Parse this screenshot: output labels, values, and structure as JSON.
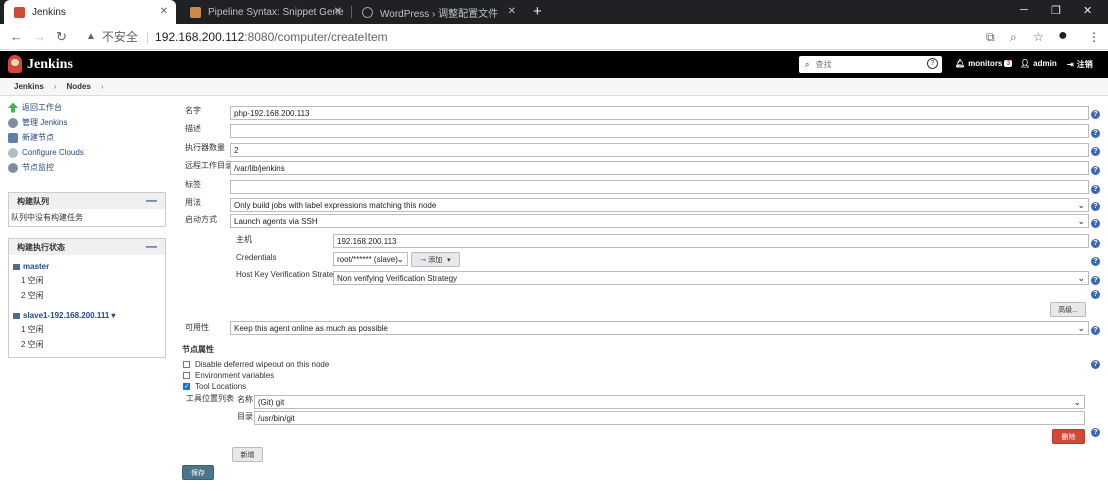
{
  "browser": {
    "tabs": [
      {
        "title": "Jenkins",
        "active": true
      },
      {
        "title": "Pipeline Syntax: Snippet Gene",
        "active": false
      },
      {
        "title": "WordPress › 调整配置文件",
        "active": false
      }
    ],
    "new_tab": "+",
    "insecure_label": "不安全",
    "url_host": "192.168.200.112",
    "url_path": ":8080/computer/createItem"
  },
  "header": {
    "brand": "Jenkins",
    "search_placeholder": "查找",
    "monitors_label": "monitors",
    "monitors_count": "3",
    "user": "admin",
    "logout": "注销"
  },
  "breadcrumb": [
    "Jenkins",
    "Nodes"
  ],
  "sidebar": {
    "tasks": [
      {
        "label": "返回工作台",
        "icon": "up-arrow-icon",
        "color": "#4caf50"
      },
      {
        "label": "管理 Jenkins",
        "icon": "gear-icon",
        "color": "#7d8fa3"
      },
      {
        "label": "新建节点",
        "icon": "computer-icon",
        "color": "#5b7fa6"
      },
      {
        "label": "Configure Clouds",
        "icon": "cloud-icon",
        "color": "#b0bec5"
      },
      {
        "label": "节点监控",
        "icon": "gear-icon",
        "color": "#7d8fa3"
      }
    ],
    "queue": {
      "title": "构建队列",
      "collapse": "—",
      "empty": "队列中没有构建任务"
    },
    "executors": {
      "title": "构建执行状态",
      "collapse": "—",
      "nodes": [
        {
          "name": "master",
          "rows": [
            "1 空闲",
            "2 空闲"
          ]
        },
        {
          "name": "slave1-192.168.200.111",
          "caret": "▾",
          "rows": [
            "1 空闲",
            "2 空闲"
          ]
        }
      ]
    }
  },
  "form": {
    "name_label": "名字",
    "name_value": "php-192.168.200.113",
    "desc_label": "描述",
    "desc_value": "",
    "executors_label": "执行器数量",
    "executors_value": "2",
    "remote_label": "远程工作目录",
    "remote_value": "/var/lib/jenkins",
    "tag_label": "标签",
    "tag_value": "",
    "usage_label": "用法",
    "usage_value": "Only build jobs with label expressions matching this node",
    "launch_label": "启动方式",
    "launch_value": "Launch agents via SSH",
    "host_label": "主机",
    "host_value": "192.168.200.113",
    "cred_label": "Credentials",
    "cred_value": "root/****** (slave)",
    "add_label": "添加",
    "hkvs_label": "Host Key Verification Strategy",
    "hkvs_value": "Non verifying Verification Strategy",
    "advanced_label": "高级...",
    "avail_label": "可用性",
    "avail_value": "Keep this agent online as much as possible",
    "props_label": "节点属性",
    "props": [
      {
        "label": "Disable deferred wipeout on this node",
        "checked": false
      },
      {
        "label": "Environment variables",
        "checked": false
      },
      {
        "label": "Tool Locations",
        "checked": true
      }
    ],
    "tool_list_label": "工具位置列表",
    "tool_name_label": "名称",
    "tool_name_value": "(Git) git",
    "tool_dir_label": "目录",
    "tool_dir_value": "/usr/bin/git",
    "delete_label": "删除",
    "new_label": "新增",
    "save_label": "保存"
  },
  "colors": {
    "primary_button": "#4b758b",
    "danger_button": "#d24939",
    "help_icon": "#3b67b3"
  }
}
